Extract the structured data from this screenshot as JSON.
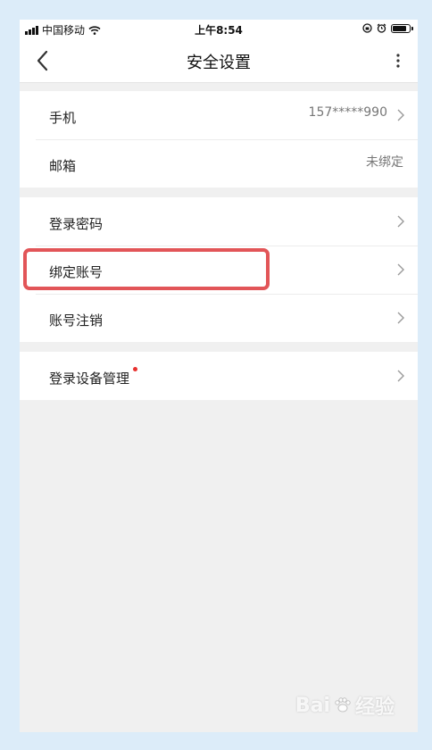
{
  "status_bar": {
    "carrier": "中国移动",
    "time": "上午8:54"
  },
  "nav": {
    "title": "安全设置",
    "back_icon": "chevron-left-icon",
    "more_icon": "more-vertical-icon"
  },
  "groups": [
    {
      "items": [
        {
          "label": "手机",
          "value": "157*****990",
          "chevron": true
        },
        {
          "label": "邮箱",
          "value": "未绑定",
          "chevron": false
        }
      ]
    },
    {
      "items": [
        {
          "label": "登录密码",
          "chevron": true
        },
        {
          "label": "绑定账号",
          "chevron": true,
          "highlighted": true
        },
        {
          "label": "账号注销",
          "chevron": true
        }
      ]
    },
    {
      "items": [
        {
          "label": "登录设备管理",
          "chevron": true,
          "badge_dot": true
        }
      ]
    }
  ],
  "colors": {
    "highlight": "#e25558",
    "badge": "#e8312f",
    "frame": "#dcecf9",
    "background": "#f0f0f0"
  },
  "watermark": {
    "text_left": "Bai",
    "text_right": "经验"
  }
}
